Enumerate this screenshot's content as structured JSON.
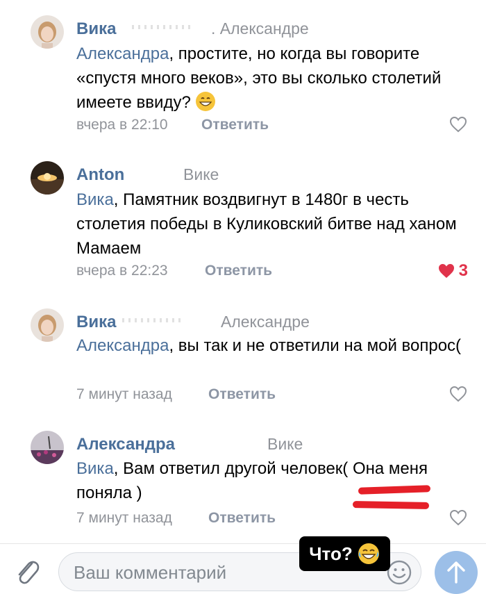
{
  "comments": [
    {
      "author": "Вика",
      "reply_to": ". Александре",
      "mention": "Александра",
      "text": ", простите, но когда вы говорите «спустя много веков», это вы сколько столетий имеете ввиду?",
      "time": "вчера в 22:10",
      "reply_label": "Ответить"
    },
    {
      "author": "Anton",
      "reply_to": "Вике",
      "mention": "Вика",
      "text": ", Памятник воздвигнут в 1480г в честь столетия победы в Куликовский битве над ханом Мамаем",
      "time": "вчера в 22:23",
      "reply_label": "Ответить",
      "likes": "3"
    },
    {
      "author": "Вика",
      "reply_to": "Александре",
      "mention": "Александра",
      "text": ", вы так и не ответили на мой вопрос(",
      "time": "7 минут назад",
      "reply_label": "Ответить"
    },
    {
      "author": "Александра",
      "reply_to": "Вике",
      "mention": "Вика",
      "text": ", Вам ответил другой человек( Она меня поняла )",
      "time": "7 минут назад",
      "reply_label": "Ответить"
    }
  ],
  "composer": {
    "placeholder": "Ваш комментарий"
  },
  "sticker": {
    "text": "Что?"
  },
  "colors": {
    "link": "#4a6f9a",
    "meta": "#909399",
    "like_active": "#e0334b",
    "send_button": "#9cbfe8"
  }
}
